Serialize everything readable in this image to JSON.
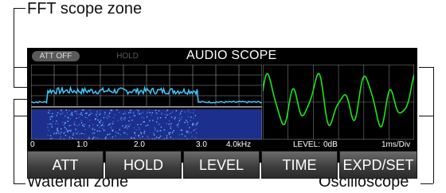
{
  "callouts": {
    "fft_zone": "FFT scope zone",
    "waterfall_zone": "Waterfall zone",
    "oscilloscope": "Oscilloscope"
  },
  "header": {
    "att_status": "ATT OFF",
    "hold_status": "HOLD",
    "title": "AUDIO SCOPE"
  },
  "fft": {
    "freq_ticks": [
      "0",
      "1.0",
      "2.0",
      "3.0",
      "4.0kHz"
    ],
    "colors": {
      "grid": "#9a9a9a",
      "spectrum": "#3ec8ff",
      "waterfall_bg": "#1c2f8c",
      "waterfall_speckle": "#6fb8ff"
    }
  },
  "oscilloscope": {
    "level_label": "LEVEL:",
    "level_value": "0dB",
    "time_div": "1ms/Div",
    "colors": {
      "trace": "#18e818",
      "grid": "#7a7a7a"
    }
  },
  "buttons": [
    {
      "label": "ATT"
    },
    {
      "label": "HOLD"
    },
    {
      "label": "LEVEL"
    },
    {
      "label": "TIME"
    },
    {
      "label": "EXPD/SET"
    }
  ]
}
